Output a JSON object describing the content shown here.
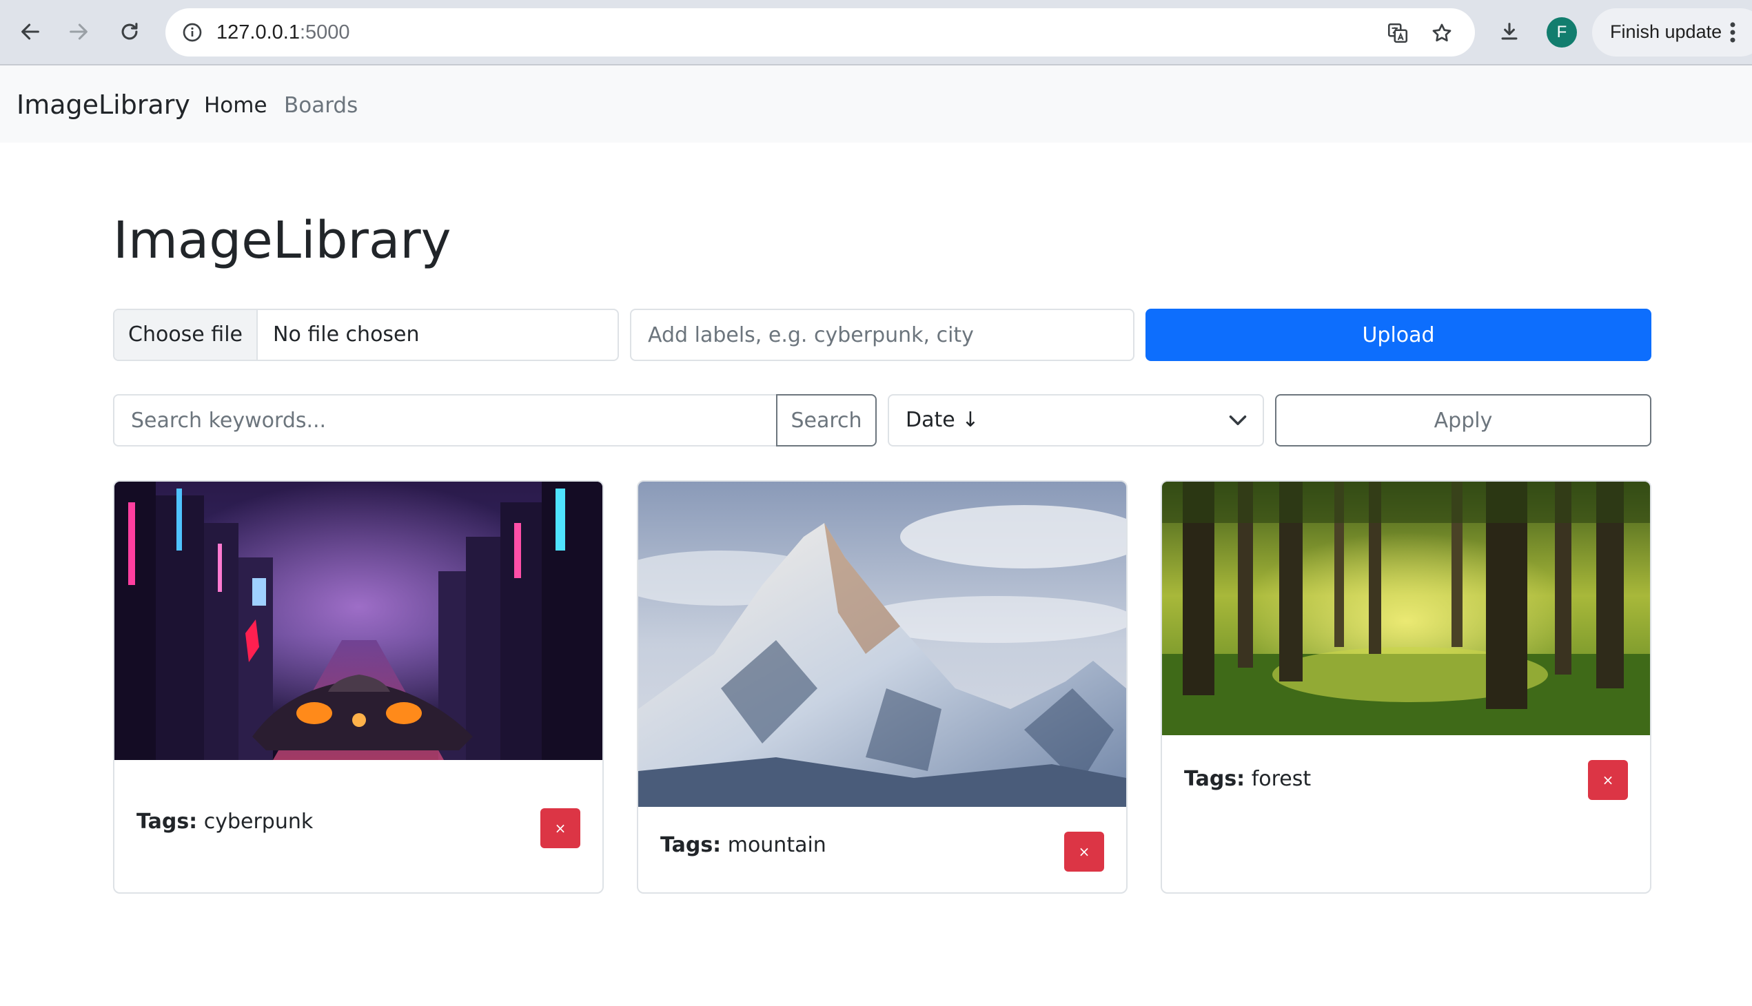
{
  "browser": {
    "url_host": "127.0.0.1",
    "url_port": ":5000",
    "profile_initial": "F",
    "finish_update_label": "Finish update"
  },
  "navbar": {
    "brand": "ImageLibrary",
    "links": [
      {
        "label": "Home",
        "active": true
      },
      {
        "label": "Boards",
        "active": false
      }
    ]
  },
  "page": {
    "title": "ImageLibrary"
  },
  "upload": {
    "choose_file_label": "Choose file",
    "file_status": "No file chosen",
    "labels_placeholder": "Add labels, e.g. cyberpunk, city",
    "upload_label": "Upload"
  },
  "filter": {
    "search_placeholder": "Search keywords...",
    "search_label": "Search",
    "sort_value": "Date ↓",
    "apply_label": "Apply"
  },
  "cards": [
    {
      "tags_label": "Tags:",
      "tags": "cyberpunk",
      "delete_label": "×",
      "image_icon": "cyberpunk-city-image"
    },
    {
      "tags_label": "Tags:",
      "tags": "mountain",
      "delete_label": "×",
      "image_icon": "mountain-image"
    },
    {
      "tags_label": "Tags:",
      "tags": "forest",
      "delete_label": "×",
      "image_icon": "forest-image"
    }
  ],
  "colors": {
    "primary": "#0d6efd",
    "danger": "#dc3545",
    "secondary": "#6c757d",
    "navbar_bg": "#f8f9fa"
  }
}
